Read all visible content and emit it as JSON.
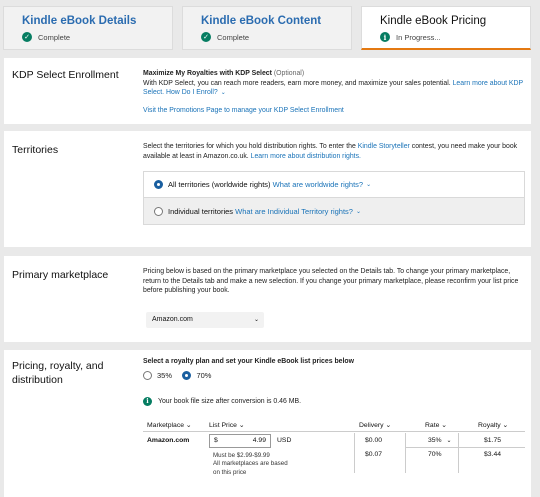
{
  "tabs": [
    {
      "title": "Kindle eBook Details",
      "status": "Complete",
      "icon": "check-circle-icon"
    },
    {
      "title": "Kindle eBook Content",
      "status": "Complete",
      "icon": "check-circle-icon"
    },
    {
      "title": "Kindle eBook Pricing",
      "status": "In Progress...",
      "icon": "info-circle-icon"
    }
  ],
  "kdp": {
    "title": "KDP Select Enrollment",
    "heading": "Maximize My Royalties with KDP Select",
    "optional": "(Optional)",
    "body": "With KDP Select, you can reach more readers, earn more money, and maximize your sales potential.",
    "learn_more": "Learn more about KDP Select.",
    "how_enroll": "How Do I Enroll?",
    "promo_link": "Visit the Promotions Page to manage your KDP Select Enrollment"
  },
  "territories": {
    "title": "Territories",
    "body": "Select the territories for which you hold distribution rights. To enter the",
    "storyteller_link": "Kindle Storyteller",
    "body2": "contest, you need make your book available at least in Amazon.co.uk.",
    "learn_more": "Learn more about distribution rights.",
    "option_all": "All territories (worldwide rights)",
    "option_all_link": "What are worldwide rights?",
    "option_individual": "Individual territories",
    "option_individual_link": "What are Individual Territory rights?"
  },
  "marketplace": {
    "title": "Primary marketplace",
    "body": "Pricing below is based on the primary marketplace you selected on the Details tab. To change your primary marketplace, return to the Details tab and make a new selection. If you change your primary marketplace, please reconfirm your list price before publishing your book.",
    "selected": "Amazon.com"
  },
  "pricing": {
    "title_line1": "Pricing, royalty, and",
    "title_line2": "distribution",
    "instruction": "Select a royalty plan and set your Kindle eBook list prices below",
    "plan_35": "35%",
    "plan_70": "70%",
    "file_size_note": "Your book file size after conversion is 0.46 MB.",
    "headers": {
      "marketplace": "Marketplace",
      "list_price": "List Price",
      "delivery": "Delivery",
      "rate": "Rate",
      "royalty": "Royalty"
    },
    "row": {
      "marketplace": "Amazon.com",
      "currency_symbol": "$",
      "price": "4.99",
      "currency": "USD",
      "price_note1": "Must be $2.99-$9.99",
      "price_note2": "All marketplaces are based on this price",
      "delivery_35": "$0.00",
      "delivery_70": "$0.07",
      "rate_35": "35%",
      "rate_70": "70%",
      "royalty_35": "$1.75",
      "royalty_70": "$3.44"
    }
  }
}
